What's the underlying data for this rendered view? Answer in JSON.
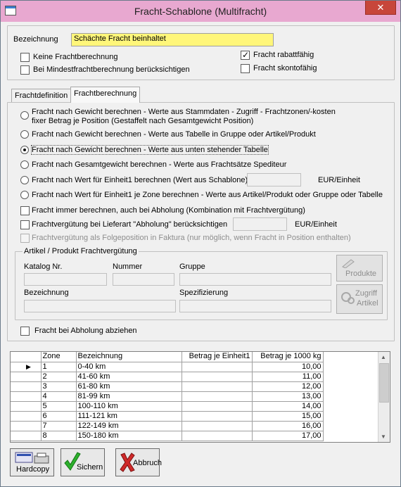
{
  "window": {
    "title": "Fracht-Schablone (Multifracht)",
    "close_glyph": "✕"
  },
  "header": {
    "bezeichnung_label": "Bezeichnung",
    "bezeichnung_value": "Schächte Fracht beinhaltet",
    "options": [
      {
        "label": "Keine Frachtberechnung",
        "checked": false
      },
      {
        "label": "Bei Mindestfrachtberechnung berücksichtigen",
        "checked": false
      },
      {
        "label": "Fracht rabattfähig",
        "checked": true
      },
      {
        "label": "Fracht skontofähig",
        "checked": false
      }
    ]
  },
  "tabs": [
    {
      "label": "Frachtdefinition",
      "active": false
    },
    {
      "label": "Frachtberechnung",
      "active": true
    }
  ],
  "radios": [
    {
      "line1": "Fracht nach Gewicht berechnen - Werte aus Stammdaten - Zugriff - Frachtzonen/-kosten",
      "line2": "fixer Betrag je Position (Gestaffelt nach Gesamtgewicht Position)",
      "selected": false
    },
    {
      "line1": "Fracht nach Gewicht berechnen - Werte aus Tabelle in Gruppe oder Artikel/Produkt",
      "selected": false
    },
    {
      "line1": "Fracht nach Gewicht berechnen - Werte aus unten stehender Tabelle",
      "selected": true
    },
    {
      "line1": "Fracht nach Gesamtgewicht berechnen - Werte aus Frachtsätze Spediteur",
      "selected": false
    },
    {
      "line1": "Fracht nach Wert für Einheit1 berechnen (Wert aus Schablone)=",
      "unit": "EUR/Einheit",
      "selected": false
    },
    {
      "line1": "Fracht nach Wert für Einheit1 je Zone berechnen - Werte aus Artikel/Produkt oder Gruppe oder Tabelle",
      "selected": false
    }
  ],
  "checks": {
    "immer": "Fracht immer berechnen, auch bei Abholung (Kombination mit Frachtvergütung)",
    "verguetung": "Frachtvergütung bei Lieferart \"Abholung\" berücksichtigen",
    "verguetung_unit": "EUR/Einheit",
    "folgeposition": "Frachtvergütung als Folgeposition in Faktura (nur möglich, wenn Fracht in Position enthalten)",
    "abziehen": "Fracht bei Abholung abziehen"
  },
  "artikel_group": {
    "title": "Artikel / Produkt Frachtvergütung",
    "katalog": "Katalog Nr.",
    "nummer": "Nummer",
    "gruppe": "Gruppe",
    "bezeichnung": "Bezeichnung",
    "spezifizierung": "Spezifizierung",
    "produkte_btn": "Produkte",
    "zugriff_btn_1": "Zugriff",
    "zugriff_btn_2": "Artikel"
  },
  "table": {
    "headers": [
      "Zone",
      "Bezeichnung",
      "Betrag je Einheit1",
      "Betrag je 1000 kg"
    ],
    "rows": [
      [
        "1",
        "0-40 km",
        "",
        "10,00"
      ],
      [
        "2",
        "41-60 km",
        "",
        "11,00"
      ],
      [
        "3",
        "61-80 km",
        "",
        "12,00"
      ],
      [
        "4",
        "81-99 km",
        "",
        "13,00"
      ],
      [
        "5",
        "100-110 km",
        "",
        "14,00"
      ],
      [
        "6",
        "111-121 km",
        "",
        "15,00"
      ],
      [
        "7",
        "122-149 km",
        "",
        "16,00"
      ],
      [
        "8",
        "150-180 km",
        "",
        "17,00"
      ]
    ],
    "current_row_marker": "▶"
  },
  "toolbar": {
    "hardcopy": "Hardcopy",
    "sichern": "Sichern",
    "abbruch": "Abbruch"
  }
}
